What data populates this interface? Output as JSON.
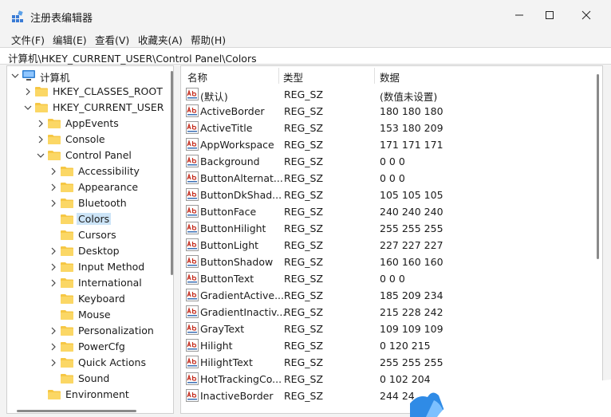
{
  "window": {
    "title": "注册表编辑器",
    "icon": "registry-icon",
    "controls": [
      "minimize-icon",
      "maximize-icon",
      "close-icon"
    ]
  },
  "menu": {
    "items": [
      {
        "label": "文件(F)"
      },
      {
        "label": "编辑(E)"
      },
      {
        "label": "查看(V)"
      },
      {
        "label": "收藏夹(A)"
      },
      {
        "label": "帮助(H)"
      }
    ]
  },
  "address": {
    "path": "计算机\\HKEY_CURRENT_USER\\Control Panel\\Colors"
  },
  "tree": {
    "nodes": [
      {
        "label": "计算机",
        "level": 0,
        "expander": "expanded",
        "icon": "computer-icon"
      },
      {
        "label": "HKEY_CLASSES_ROOT",
        "level": 1,
        "expander": "collapsed",
        "icon": "folder-icon"
      },
      {
        "label": "HKEY_CURRENT_USER",
        "level": 1,
        "expander": "expanded",
        "icon": "folder-icon"
      },
      {
        "label": "AppEvents",
        "level": 2,
        "expander": "collapsed",
        "icon": "folder-icon"
      },
      {
        "label": "Console",
        "level": 2,
        "expander": "collapsed",
        "icon": "folder-icon"
      },
      {
        "label": "Control Panel",
        "level": 2,
        "expander": "expanded",
        "icon": "folder-icon"
      },
      {
        "label": "Accessibility",
        "level": 3,
        "expander": "collapsed",
        "icon": "folder-icon"
      },
      {
        "label": "Appearance",
        "level": 3,
        "expander": "collapsed",
        "icon": "folder-icon"
      },
      {
        "label": "Bluetooth",
        "level": 3,
        "expander": "collapsed",
        "icon": "folder-icon"
      },
      {
        "label": "Colors",
        "level": 3,
        "expander": "none",
        "icon": "folder-icon",
        "selected": true
      },
      {
        "label": "Cursors",
        "level": 3,
        "expander": "none",
        "icon": "folder-icon"
      },
      {
        "label": "Desktop",
        "level": 3,
        "expander": "collapsed",
        "icon": "folder-icon"
      },
      {
        "label": "Input Method",
        "level": 3,
        "expander": "collapsed",
        "icon": "folder-icon"
      },
      {
        "label": "International",
        "level": 3,
        "expander": "collapsed",
        "icon": "folder-icon"
      },
      {
        "label": "Keyboard",
        "level": 3,
        "expander": "none",
        "icon": "folder-icon"
      },
      {
        "label": "Mouse",
        "level": 3,
        "expander": "none",
        "icon": "folder-icon"
      },
      {
        "label": "Personalization",
        "level": 3,
        "expander": "collapsed",
        "icon": "folder-icon"
      },
      {
        "label": "PowerCfg",
        "level": 3,
        "expander": "collapsed",
        "icon": "folder-icon"
      },
      {
        "label": "Quick Actions",
        "level": 3,
        "expander": "collapsed",
        "icon": "folder-icon"
      },
      {
        "label": "Sound",
        "level": 3,
        "expander": "none",
        "icon": "folder-icon"
      },
      {
        "label": "Environment",
        "level": 2,
        "expander": "none",
        "icon": "folder-icon"
      }
    ]
  },
  "list": {
    "headers": {
      "name": "名称",
      "type": "类型",
      "data": "数据"
    },
    "value_icon": "string-value-icon",
    "rows": [
      {
        "name": "(默认)",
        "type": "REG_SZ",
        "data": "(数值未设置)"
      },
      {
        "name": "ActiveBorder",
        "type": "REG_SZ",
        "data": "180 180 180"
      },
      {
        "name": "ActiveTitle",
        "type": "REG_SZ",
        "data": "153 180 209"
      },
      {
        "name": "AppWorkspace",
        "type": "REG_SZ",
        "data": "171 171 171"
      },
      {
        "name": "Background",
        "type": "REG_SZ",
        "data": "0 0 0"
      },
      {
        "name": "ButtonAlternat...",
        "type": "REG_SZ",
        "data": "0 0 0"
      },
      {
        "name": "ButtonDkShad...",
        "type": "REG_SZ",
        "data": "105 105 105"
      },
      {
        "name": "ButtonFace",
        "type": "REG_SZ",
        "data": "240 240 240"
      },
      {
        "name": "ButtonHilight",
        "type": "REG_SZ",
        "data": "255 255 255"
      },
      {
        "name": "ButtonLight",
        "type": "REG_SZ",
        "data": "227 227 227"
      },
      {
        "name": "ButtonShadow",
        "type": "REG_SZ",
        "data": "160 160 160"
      },
      {
        "name": "ButtonText",
        "type": "REG_SZ",
        "data": "0 0 0"
      },
      {
        "name": "GradientActive...",
        "type": "REG_SZ",
        "data": "185 209 234"
      },
      {
        "name": "GradientInactiv...",
        "type": "REG_SZ",
        "data": "215 228 242"
      },
      {
        "name": "GrayText",
        "type": "REG_SZ",
        "data": "109 109 109"
      },
      {
        "name": "Hilight",
        "type": "REG_SZ",
        "data": "0 120 215"
      },
      {
        "name": "HilightText",
        "type": "REG_SZ",
        "data": "255 255 255"
      },
      {
        "name": "HotTrackingCo...",
        "type": "REG_SZ",
        "data": "0 102 204"
      },
      {
        "name": "InactiveBorder",
        "type": "REG_SZ",
        "data": "244 24"
      }
    ]
  },
  "colors": {
    "selection": "#cce4f7",
    "folder": "#f6c744",
    "ab_red": "#c42b1c",
    "ab_blue": "#3a6fb5"
  }
}
